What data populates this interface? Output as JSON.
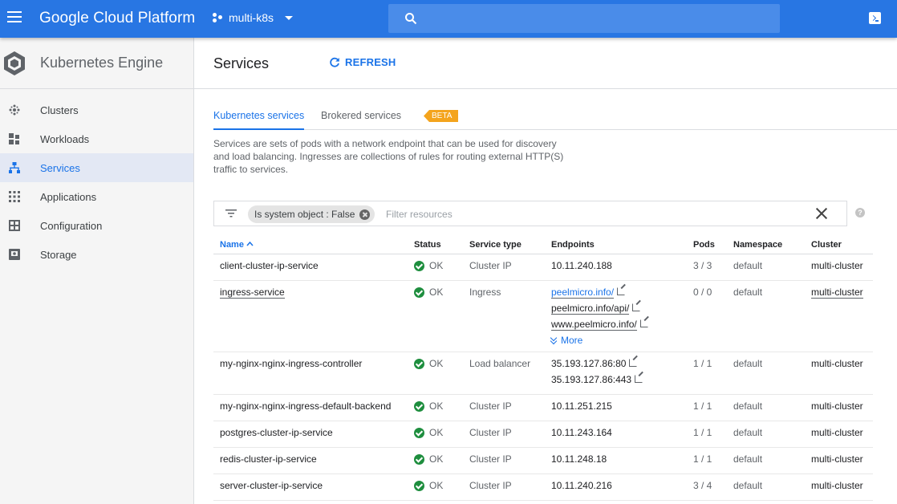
{
  "header": {
    "brand": "Google Cloud Platform",
    "project": "multi-k8s",
    "search_placeholder": ""
  },
  "sidebar": {
    "product_title": "Kubernetes Engine",
    "items": [
      {
        "label": "Clusters",
        "icon": "clusters-icon"
      },
      {
        "label": "Workloads",
        "icon": "workloads-icon"
      },
      {
        "label": "Services",
        "icon": "services-icon",
        "active": true
      },
      {
        "label": "Applications",
        "icon": "applications-icon"
      },
      {
        "label": "Configuration",
        "icon": "configuration-icon"
      },
      {
        "label": "Storage",
        "icon": "storage-icon"
      }
    ]
  },
  "page": {
    "title": "Services",
    "refresh_label": "REFRESH",
    "tabs": [
      {
        "label": "Kubernetes services",
        "active": true
      },
      {
        "label": "Brokered services",
        "badge": "BETA"
      }
    ],
    "description": "Services are sets of pods with a network endpoint that can be used for discovery and load balancing. Ingresses are collections of rules for routing external HTTP(S) traffic to services."
  },
  "filter": {
    "chip_key": "Is system object",
    "chip_sep": " : ",
    "chip_value": "False",
    "placeholder": "Filter resources",
    "help": "?"
  },
  "table": {
    "headers": {
      "name": "Name",
      "status": "Status",
      "type": "Service type",
      "endpoints": "Endpoints",
      "pods": "Pods",
      "namespace": "Namespace",
      "cluster": "Cluster"
    },
    "rows": [
      {
        "name": "client-cluster-ip-service",
        "status": "OK",
        "type": "Cluster IP",
        "endpoints": [
          "10.11.240.188"
        ],
        "pods": "3 / 3",
        "namespace": "default",
        "cluster": "multi-cluster"
      },
      {
        "name": "ingress-service",
        "status": "OK",
        "type": "Ingress",
        "endpoints": [
          "peelmicro.info/",
          "peelmicro.info/api/",
          "www.peelmicro.info/"
        ],
        "more": "More",
        "pods": "0 / 0",
        "namespace": "default",
        "cluster": "multi-cluster"
      },
      {
        "name": "my-nginx-nginx-ingress-controller",
        "status": "OK",
        "type": "Load balancer",
        "endpoints": [
          "35.193.127.86:80",
          "35.193.127.86:443"
        ],
        "pods": "1 / 1",
        "namespace": "default",
        "cluster": "multi-cluster"
      },
      {
        "name": "my-nginx-nginx-ingress-default-backend",
        "status": "OK",
        "type": "Cluster IP",
        "endpoints": [
          "10.11.251.215"
        ],
        "pods": "1 / 1",
        "namespace": "default",
        "cluster": "multi-cluster"
      },
      {
        "name": "postgres-cluster-ip-service",
        "status": "OK",
        "type": "Cluster IP",
        "endpoints": [
          "10.11.243.164"
        ],
        "pods": "1 / 1",
        "namespace": "default",
        "cluster": "multi-cluster"
      },
      {
        "name": "redis-cluster-ip-service",
        "status": "OK",
        "type": "Cluster IP",
        "endpoints": [
          "10.11.248.18"
        ],
        "pods": "1 / 1",
        "namespace": "default",
        "cluster": "multi-cluster"
      },
      {
        "name": "server-cluster-ip-service",
        "status": "OK",
        "type": "Cluster IP",
        "endpoints": [
          "10.11.240.216"
        ],
        "pods": "3 / 4",
        "namespace": "default",
        "cluster": "multi-cluster"
      }
    ]
  }
}
